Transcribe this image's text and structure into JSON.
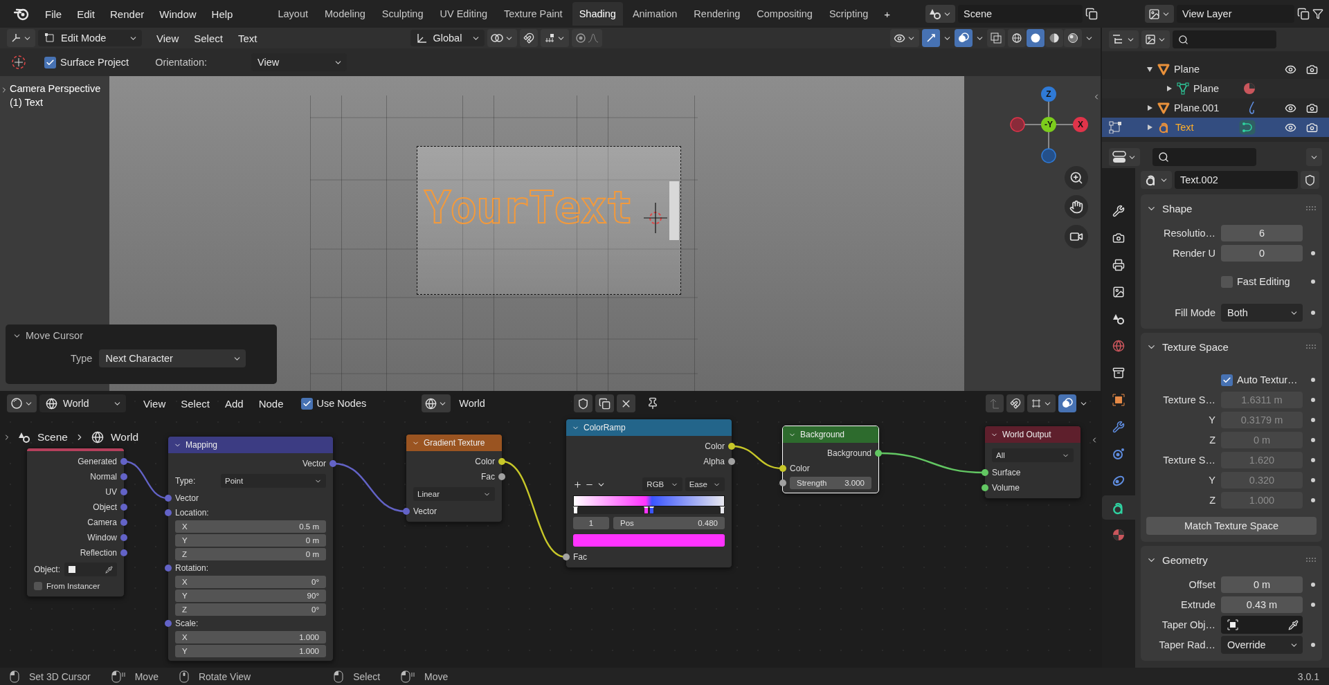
{
  "topbar": {
    "menus": [
      "File",
      "Edit",
      "Render",
      "Window",
      "Help"
    ],
    "workspaces": [
      {
        "label": "Layout",
        "selected": false
      },
      {
        "label": "Modeling",
        "selected": false
      },
      {
        "label": "Sculpting",
        "selected": false
      },
      {
        "label": "UV Editing",
        "selected": false
      },
      {
        "label": "Texture Paint",
        "selected": false
      },
      {
        "label": "Shading",
        "selected": true
      },
      {
        "label": "Animation",
        "selected": false
      },
      {
        "label": "Rendering",
        "selected": false
      },
      {
        "label": "Compositing",
        "selected": false
      },
      {
        "label": "Scripting",
        "selected": false
      }
    ],
    "add_workspace": "+",
    "scene": "Scene",
    "view_layer": "View Layer"
  },
  "viewport": {
    "header": {
      "mode": "Edit Mode",
      "menus": [
        "View",
        "Select",
        "Text"
      ],
      "orientation": "Global",
      "shading_modes": [
        {
          "kind": "wireframe",
          "selected": false
        },
        {
          "kind": "solid",
          "selected": true
        },
        {
          "kind": "material",
          "selected": false
        },
        {
          "kind": "rendered",
          "selected": false
        }
      ]
    },
    "tool_settings": {
      "surface_project": {
        "label": "Surface Project",
        "checked": true
      },
      "orientation_label": "Orientation:",
      "orientation": "View"
    },
    "overlay_lines": [
      "Camera Perspective",
      "(1) Text"
    ],
    "text_object": "YourText",
    "gizmo": [
      {
        "kind": "z",
        "label": "Z"
      },
      {
        "kind": "y",
        "label": "-Y"
      },
      {
        "kind": "x",
        "label": "X"
      }
    ],
    "operator_panel": {
      "title": "Move Cursor",
      "expanded": true,
      "label": "Type",
      "value": "Next Character"
    }
  },
  "node_editor": {
    "header": {
      "type": "World",
      "menus": [
        "View",
        "Select",
        "Add",
        "Node"
      ],
      "use_nodes": {
        "label": "Use Nodes",
        "checked": true
      },
      "world": "World"
    },
    "breadcrumb": [
      "Scene",
      "World"
    ],
    "nodes": [
      {
        "color": "#b5405c",
        "selected": false,
        "rows": [
          {
            "kind": "output",
            "label": "Generated",
            "color": "#6363c7"
          },
          {
            "kind": "output",
            "label": "Normal",
            "color": "#6363c7"
          },
          {
            "kind": "output",
            "label": "UV",
            "color": "#6363c7"
          },
          {
            "kind": "output",
            "label": "Object",
            "color": "#6363c7"
          },
          {
            "kind": "output",
            "label": "Camera",
            "color": "#6363c7"
          },
          {
            "kind": "output",
            "label": "Window",
            "color": "#6363c7"
          },
          {
            "kind": "output",
            "label": "Reflection",
            "color": "#6363c7"
          },
          {
            "kind": "object",
            "label": "Object:"
          },
          {
            "kind": "checkbox",
            "label": "From Instancer",
            "checked": false
          }
        ]
      },
      {
        "title": "Mapping",
        "color": "#3c3c83",
        "selected": false,
        "rows": [
          {
            "kind": "output",
            "label": "Vector",
            "color": "#6363c7"
          },
          {
            "kind": "dropdown",
            "label": "Type:",
            "value": "Point"
          },
          {
            "kind": "input",
            "label": "Vector",
            "color": "#6363c7"
          },
          {
            "kind": "label",
            "label": "Location:",
            "color": "#6363c7"
          },
          {
            "kind": "field",
            "label": "X",
            "value": "0.5 m"
          },
          {
            "kind": "field",
            "label": "Y",
            "value": "0 m"
          },
          {
            "kind": "field",
            "label": "Z",
            "value": "0 m"
          },
          {
            "kind": "label",
            "label": "Rotation:",
            "color": "#6363c7"
          },
          {
            "kind": "field",
            "label": "X",
            "value": "0°"
          },
          {
            "kind": "field",
            "label": "Y",
            "value": "90°"
          },
          {
            "kind": "field",
            "label": "Z",
            "value": "0°"
          },
          {
            "kind": "label",
            "label": "Scale:",
            "color": "#6363c7"
          },
          {
            "kind": "field",
            "label": "X",
            "value": "1.000"
          },
          {
            "kind": "field",
            "label": "Y",
            "value": "1.000"
          }
        ]
      },
      {
        "title": "Gradient Texture",
        "color": "#9a5421",
        "selected": false,
        "rows": [
          {
            "kind": "output",
            "label": "Color",
            "color": "#c7c729"
          },
          {
            "kind": "output",
            "label": "Fac",
            "color": "#a1a1a1"
          },
          {
            "kind": "dropdown",
            "value": "Linear"
          },
          {
            "kind": "input",
            "label": "Vector",
            "color": "#6363c7"
          }
        ]
      },
      {
        "title": "ColorRamp",
        "color": "#23658a",
        "selected": false,
        "rows": [
          {
            "kind": "output",
            "label": "Color",
            "color": "#c7c729"
          },
          {
            "kind": "output",
            "label": "Alpha",
            "color": "#a1a1a1"
          },
          {
            "kind": "ramp_controls",
            "mode": "RGB",
            "interpolation": "Ease"
          },
          {
            "kind": "ramp",
            "stops": [
              {
                "color": "#ffffff",
                "level": 0
              },
              {
                "color": "#ff33ff",
                "level": 0.48
              },
              {
                "color": "#3a55ff",
                "level": 0.52
              },
              {
                "color": "#e8e8ee",
                "level": 1
              }
            ]
          },
          {
            "kind": "pos",
            "index": "1",
            "label": "Pos",
            "value": "0.480"
          },
          {
            "kind": "swatch",
            "color": "#ff33ff"
          },
          {
            "kind": "input",
            "label": "Fac",
            "color": "#a1a1a1"
          }
        ]
      },
      {
        "title": "Background",
        "color": "#2d6b2d",
        "selected": true,
        "rows": [
          {
            "kind": "output",
            "label": "Background",
            "color": "#63c763"
          },
          {
            "kind": "input",
            "label": "Color",
            "color": "#c7c729"
          },
          {
            "kind": "field",
            "label": "Strength",
            "value": "3.000",
            "color": "#a1a1a1"
          }
        ]
      },
      {
        "title": "World Output",
        "color": "#5e1f2c",
        "selected": false,
        "rows": [
          {
            "kind": "dropdown",
            "value": "All"
          },
          {
            "kind": "input",
            "label": "Surface",
            "color": "#63c763"
          },
          {
            "kind": "input",
            "label": "Volume",
            "color": "#63c763"
          }
        ]
      }
    ]
  },
  "outliner": {
    "items": [
      {
        "name": "Plane",
        "kind": "mesh_object",
        "expanded": true,
        "selected": false,
        "editing": false,
        "toggles": true,
        "children": [
          {
            "name": "Plane",
            "kind": "mesh",
            "expanded": false,
            "selected": false,
            "editing": false,
            "toggles": false,
            "badge": {
              "kind": "material"
            }
          }
        ]
      },
      {
        "name": "Plane.001",
        "kind": "mesh_object",
        "expanded": false,
        "selected": false,
        "editing": false,
        "toggles": true,
        "badge": {
          "kind": "modifier"
        }
      },
      {
        "name": "Text",
        "kind": "text_object",
        "expanded": false,
        "selected": true,
        "editing": true,
        "toggles": true,
        "badge": {
          "kind": "curve"
        }
      }
    ]
  },
  "properties": {
    "tabs": [
      {
        "kind": "tool",
        "selected": false
      },
      {
        "kind": "render",
        "selected": false
      },
      {
        "kind": "output",
        "selected": false
      },
      {
        "kind": "view_layer",
        "selected": false
      },
      {
        "kind": "scene",
        "selected": false
      },
      {
        "kind": "world",
        "selected": false
      },
      {
        "kind": "collection",
        "selected": false
      },
      {
        "kind": "object",
        "selected": false
      },
      {
        "kind": "modifier",
        "selected": false
      },
      {
        "kind": "particles",
        "selected": false
      },
      {
        "kind": "physics",
        "selected": false
      },
      {
        "kind": "data",
        "selected": true
      },
      {
        "kind": "material",
        "selected": false
      }
    ],
    "datablock": "Text.002",
    "panels": [
      {
        "title": "Shape",
        "expanded": true,
        "rows": [
          {
            "kind": "number",
            "label": "Resolutio…",
            "value": "6",
            "animatable": false
          },
          {
            "kind": "number",
            "label": "Render U",
            "value": "0",
            "animatable": true
          },
          {
            "kind": "checkbox",
            "label": "Fast Editing",
            "checked": false,
            "animatable": true
          },
          {
            "kind": "dropdown",
            "label": "Fill Mode",
            "value": "Both",
            "animatable": true
          }
        ]
      },
      {
        "title": "Texture Space",
        "expanded": true,
        "rows": [
          {
            "kind": "checkbox",
            "label": "Auto Textur…",
            "checked": true,
            "animatable": true
          },
          {
            "kind": "number",
            "label": "Texture S…",
            "value": "1.6311 m",
            "disabled": true,
            "animatable": true
          },
          {
            "kind": "number",
            "label": "Y",
            "value": "0.3179 m",
            "disabled": true,
            "animatable": true
          },
          {
            "kind": "number",
            "label": "Z",
            "value": "0 m",
            "disabled": true,
            "animatable": true
          },
          {
            "kind": "number",
            "label": "Texture S…",
            "value": "1.620",
            "disabled": true,
            "animatable": true
          },
          {
            "kind": "number",
            "label": "Y",
            "value": "0.320",
            "disabled": true,
            "animatable": true
          },
          {
            "kind": "number",
            "label": "Z",
            "value": "1.000",
            "disabled": true,
            "animatable": true
          },
          {
            "kind": "button",
            "label": "Match Texture Space"
          }
        ]
      },
      {
        "title": "Geometry",
        "expanded": true,
        "rows": [
          {
            "kind": "number",
            "label": "Offset",
            "value": "0 m",
            "animatable": true
          },
          {
            "kind": "number",
            "label": "Extrude",
            "value": "0.43 m",
            "animatable": true
          },
          {
            "kind": "object",
            "label": "Taper Obj…"
          },
          {
            "kind": "dropdown",
            "label": "Taper Rad…",
            "value": "Override",
            "animatable": true
          }
        ]
      }
    ]
  },
  "status_bar": {
    "groups": [
      [
        {
          "kind": "mouse_left",
          "label": "Set 3D Cursor"
        },
        {
          "kind": "mouse_drag",
          "label": "Move"
        },
        {
          "kind": "mouse_middle",
          "label": "Rotate View"
        }
      ],
      [
        {
          "kind": "mouse_left",
          "label": "Select"
        },
        {
          "kind": "mouse_drag",
          "label": "Move"
        }
      ]
    ],
    "version": "3.0.1"
  }
}
